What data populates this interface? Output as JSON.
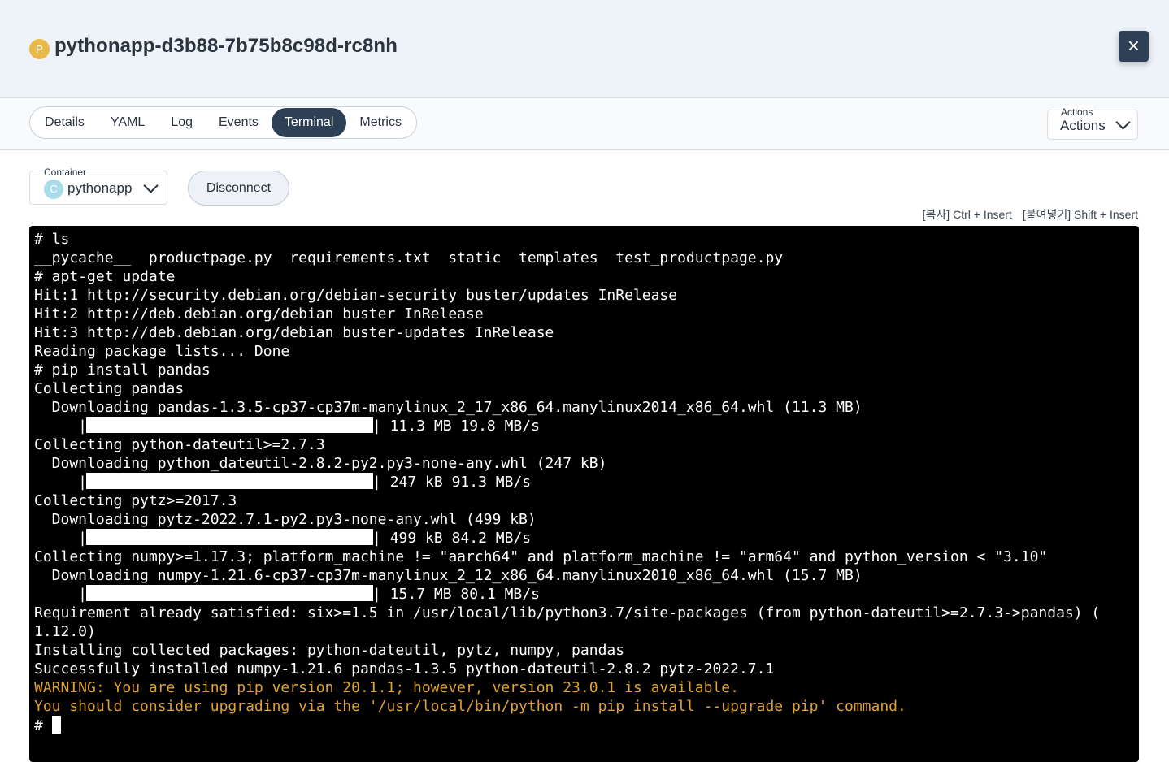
{
  "header": {
    "pod_badge": "P",
    "pod_name": "pythonapp-d3b88-7b75b8c98d-rc8nh",
    "close_icon": "close-icon"
  },
  "tabs": [
    {
      "label": "Details",
      "active": false
    },
    {
      "label": "YAML",
      "active": false
    },
    {
      "label": "Log",
      "active": false
    },
    {
      "label": "Events",
      "active": false
    },
    {
      "label": "Terminal",
      "active": true
    },
    {
      "label": "Metrics",
      "active": false
    }
  ],
  "actions": {
    "label": "Actions",
    "value": "Actions"
  },
  "container": {
    "label": "Container",
    "badge": "C",
    "value": "pythonapp"
  },
  "disconnect_label": "Disconnect",
  "hints": {
    "copy": "[복사] Ctrl + Insert",
    "paste": "[붙여넣기] Shift + Insert"
  },
  "terminal": {
    "lines": [
      {
        "text": "# ls"
      },
      {
        "text": "__pycache__  productpage.py  requirements.txt  static  templates  test_productpage.py"
      },
      {
        "text": "# apt-get update"
      },
      {
        "text": "Hit:1 http://security.debian.org/debian-security buster/updates InRelease"
      },
      {
        "text": "Hit:2 http://deb.debian.org/debian buster InRelease"
      },
      {
        "text": "Hit:3 http://deb.debian.org/debian buster-updates InRelease"
      },
      {
        "text": "Reading package lists... Done"
      },
      {
        "text": "# pip install pandas"
      },
      {
        "text": "Collecting pandas"
      },
      {
        "text": "  Downloading pandas-1.3.5-cp37-cp37m-manylinux_2_17_x86_64.manylinux2014_x86_64.whl (11.3 MB)"
      },
      {
        "progress": 1.0,
        "suffix": "| 11.3 MB 19.8 MB/s"
      },
      {
        "text": "Collecting python-dateutil>=2.7.3"
      },
      {
        "text": "  Downloading python_dateutil-2.8.2-py2.py3-none-any.whl (247 kB)"
      },
      {
        "progress": 1.0,
        "suffix": "| 247 kB 91.3 MB/s"
      },
      {
        "text": "Collecting pytz>=2017.3"
      },
      {
        "text": "  Downloading pytz-2022.7.1-py2.py3-none-any.whl (499 kB)"
      },
      {
        "progress": 1.0,
        "suffix": "| 499 kB 84.2 MB/s"
      },
      {
        "text": "Collecting numpy>=1.17.3; platform_machine != \"aarch64\" and platform_machine != \"arm64\" and python_version < \"3.10\""
      },
      {
        "text": "  Downloading numpy-1.21.6-cp37-cp37m-manylinux_2_12_x86_64.manylinux2010_x86_64.whl (15.7 MB)"
      },
      {
        "progress": 1.0,
        "suffix": "| 15.7 MB 80.1 MB/s"
      },
      {
        "text": "Requirement already satisfied: six>=1.5 in /usr/local/lib/python3.7/site-packages (from python-dateutil>=2.7.3->pandas) ("
      },
      {
        "text": "1.12.0)"
      },
      {
        "text": "Installing collected packages: python-dateutil, pytz, numpy, pandas"
      },
      {
        "text": "Successfully installed numpy-1.21.6 pandas-1.3.5 python-dateutil-2.8.2 pytz-2022.7.1"
      },
      {
        "text": "WARNING: You are using pip version 20.1.1; however, version 23.0.1 is available.",
        "warn": true
      },
      {
        "text": "You should consider upgrading via the '/usr/local/bin/python -m pip install --upgrade pip' command.",
        "warn": true
      },
      {
        "prompt": "# "
      }
    ],
    "warning_color": "#e0a230",
    "background_color": "#000000"
  },
  "colors": {
    "accent": "#2e4055",
    "header_bg": "#eef3f9",
    "pod_badge": "#e9b949",
    "container_badge": "#a9dce8"
  }
}
